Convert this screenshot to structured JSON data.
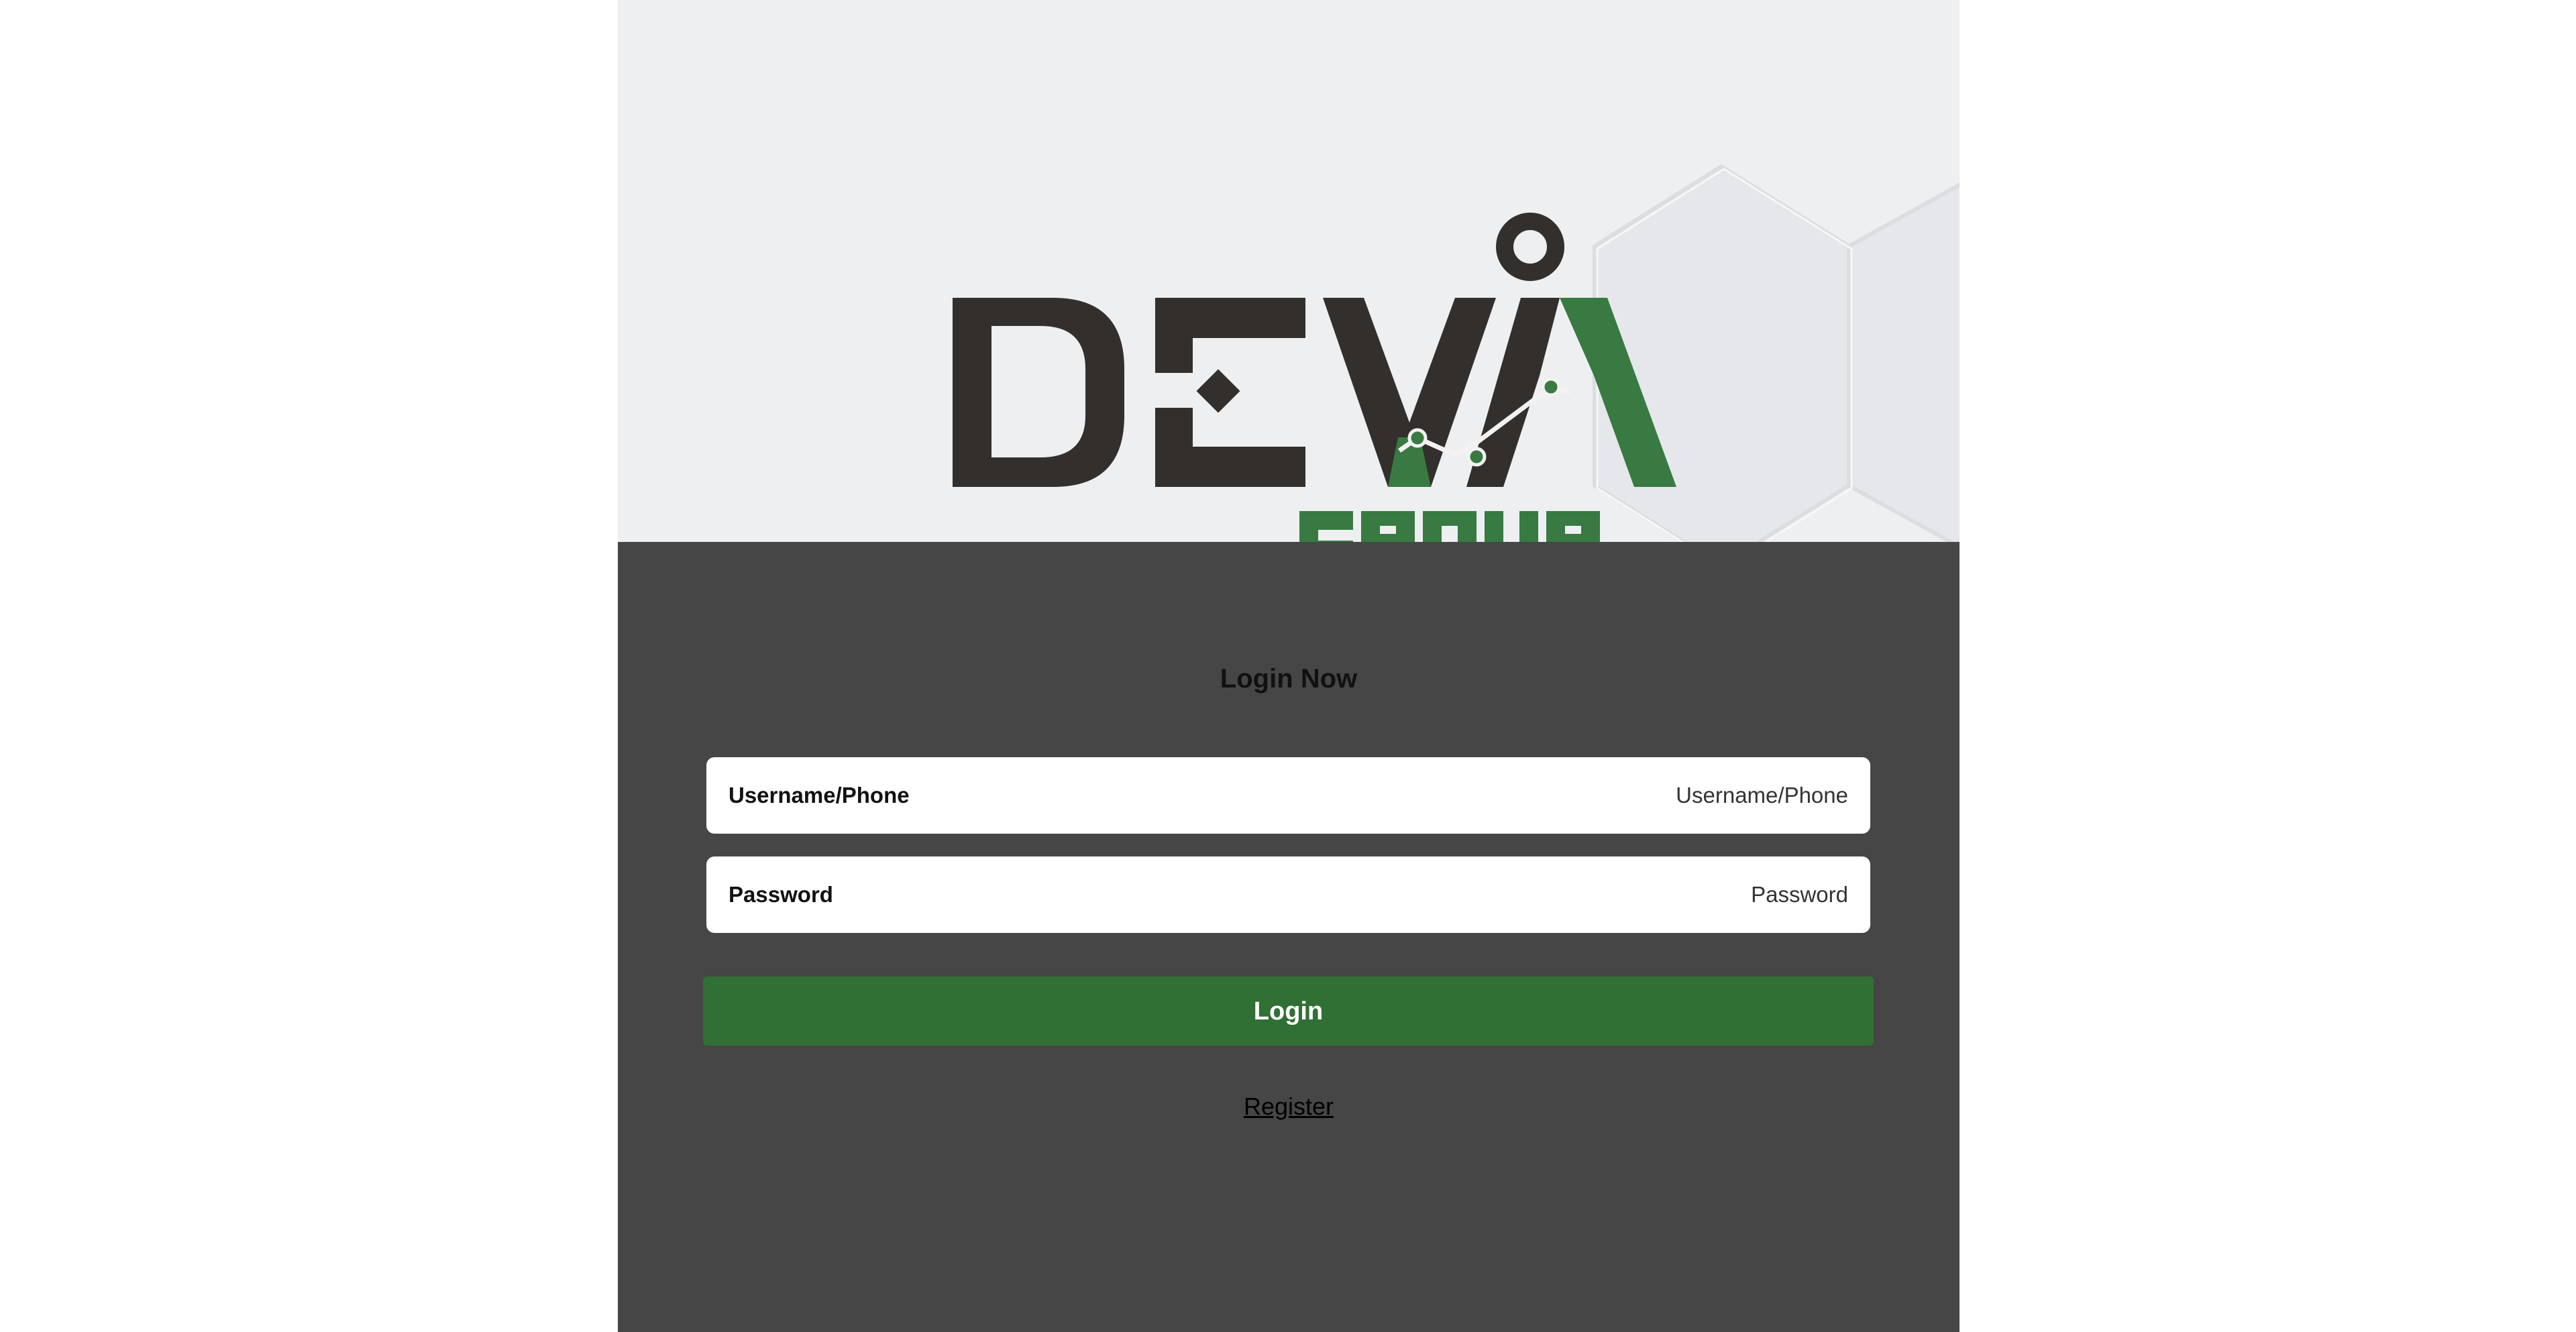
{
  "brand": {
    "logo_text": "DEVA",
    "logo_subtext": "GROUP",
    "colors": {
      "dark": "#332f2c",
      "green": "#387a41",
      "hero_bg": "#eeeff1",
      "panel_bg": "#464646",
      "button_bg": "#317034"
    }
  },
  "form": {
    "title": "Login Now",
    "username": {
      "label": "Username/Phone",
      "placeholder": "Username/Phone",
      "value": ""
    },
    "password": {
      "label": "Password",
      "placeholder": "Password",
      "value": ""
    },
    "login_label": "Login",
    "register_label": "Register"
  }
}
